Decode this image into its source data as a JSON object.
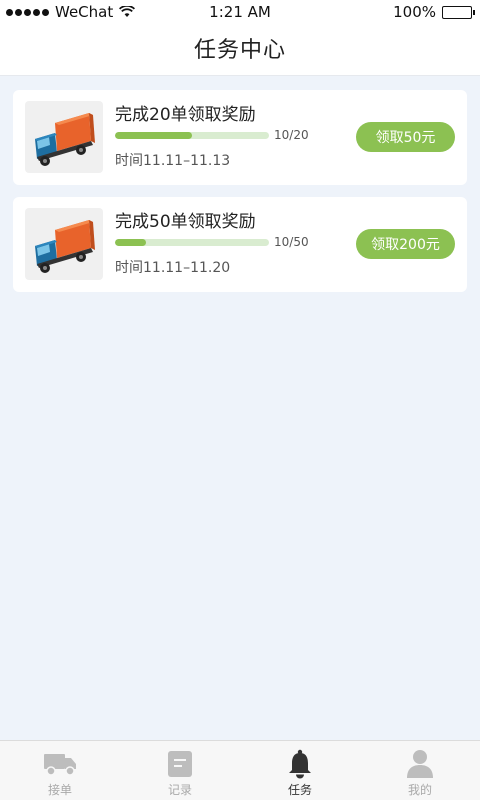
{
  "status_bar": {
    "carrier": "WeChat",
    "time": "1:21 AM",
    "battery": "100%"
  },
  "header": {
    "title": "任务中心"
  },
  "tasks": [
    {
      "title": "完成20单领取奖励",
      "progress_text": "10/20",
      "progress_fraction": 0.5,
      "time": "时间11.11–11.13",
      "button": "领取50元",
      "thumbnail_icon": "truck-icon"
    },
    {
      "title": "完成50单领取奖励",
      "progress_text": "10/50",
      "progress_fraction": 0.2,
      "time": "时间11.11–11.20",
      "button": "领取200元",
      "thumbnail_icon": "truck-icon"
    }
  ],
  "tabbar": {
    "items": [
      {
        "label": "接单",
        "icon": "truck-icon",
        "active": false
      },
      {
        "label": "记录",
        "icon": "document-icon",
        "active": false
      },
      {
        "label": "任务",
        "icon": "bell-icon",
        "active": true
      },
      {
        "label": "我的",
        "icon": "user-icon",
        "active": false
      }
    ]
  },
  "colors": {
    "accent": "#8cc152",
    "progress_track": "#d9ecd0",
    "page_bg": "#eef3fa",
    "tab_inactive": "#a9a9a9",
    "tab_active": "#333333"
  }
}
